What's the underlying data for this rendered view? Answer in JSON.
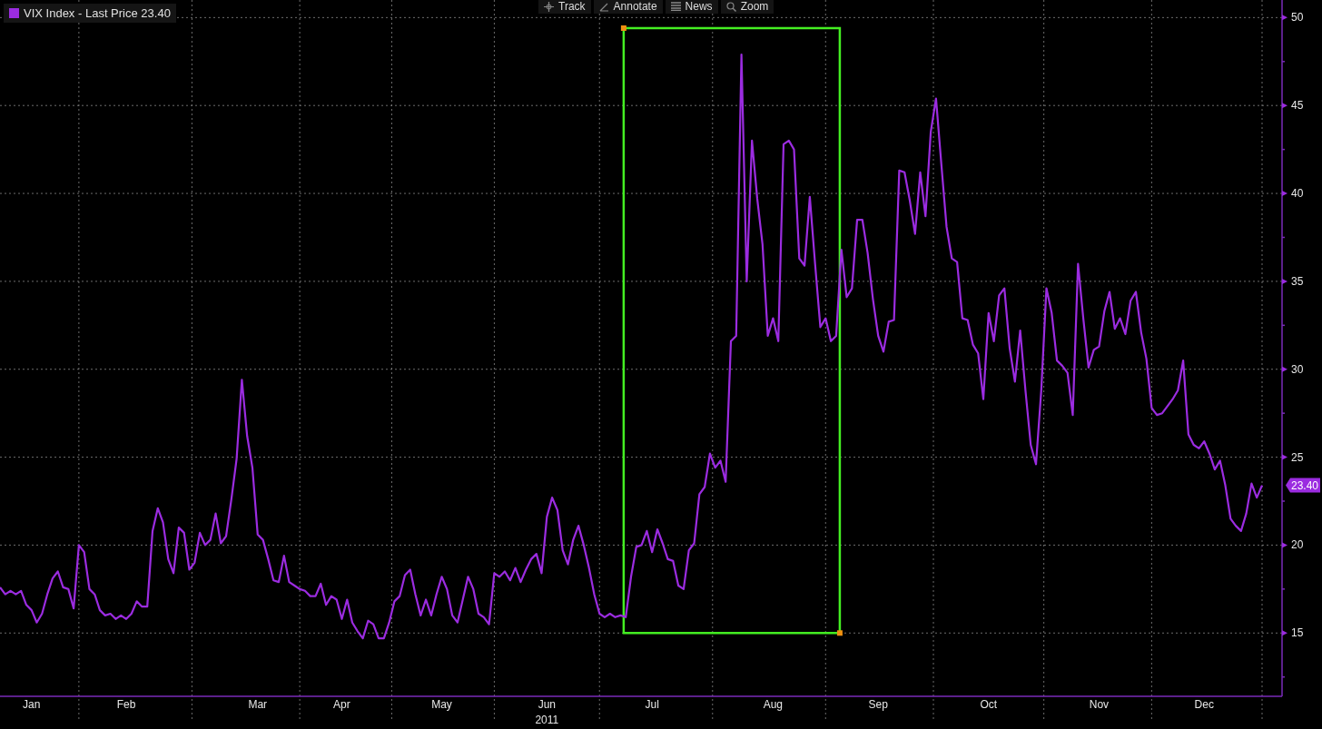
{
  "legend": {
    "value": "23.40"
  },
  "toolbar": [
    {
      "label": "Track",
      "kind": "track"
    },
    {
      "label": "Annotate",
      "kind": "annotate"
    },
    {
      "label": "News",
      "kind": "news"
    },
    {
      "label": "Zoom",
      "kind": "zoom"
    }
  ],
  "last_price_badge": "23.40",
  "chart_data": {
    "type": "line",
    "xlabel": "2011",
    "ylim": [
      11.4,
      51.0
    ],
    "categories": [
      null,
      null,
      null,
      null,
      null,
      null,
      "Jan",
      null,
      null,
      null,
      null,
      null,
      null,
      null,
      null,
      null,
      null,
      null,
      null,
      null,
      null,
      null,
      null,
      null,
      "Feb",
      null,
      null,
      null,
      null,
      null,
      null,
      null,
      null,
      null,
      null,
      null,
      null,
      null,
      null,
      null,
      null,
      null,
      null,
      null,
      null,
      null,
      null,
      null,
      null,
      "Mar",
      null,
      null,
      null,
      null,
      null,
      null,
      null,
      null,
      null,
      null,
      null,
      null,
      null,
      null,
      null,
      "Apr",
      null,
      null,
      null,
      null,
      null,
      null,
      null,
      null,
      null,
      null,
      null,
      null,
      null,
      null,
      null,
      null,
      null,
      null,
      "May",
      null,
      null,
      null,
      null,
      null,
      null,
      null,
      null,
      null,
      null,
      null,
      null,
      null,
      null,
      null,
      null,
      null,
      null,
      null,
      "Jun",
      null,
      null,
      null,
      null,
      null,
      null,
      null,
      null,
      null,
      null,
      null,
      null,
      null,
      null,
      null,
      null,
      null,
      null,
      null,
      "Jul",
      null,
      null,
      null,
      null,
      null,
      null,
      null,
      null,
      null,
      null,
      null,
      null,
      null,
      null,
      null,
      null,
      null,
      null,
      null,
      null,
      null,
      null,
      "Aug",
      null,
      null,
      null,
      null,
      null,
      null,
      null,
      null,
      null,
      null,
      null,
      null,
      null,
      null,
      null,
      null,
      null,
      null,
      null,
      "Sep",
      null,
      null,
      null,
      null,
      null,
      null,
      null,
      null,
      null,
      null,
      null,
      null,
      null,
      null,
      null,
      null,
      null,
      null,
      null,
      null,
      "Oct",
      null,
      null,
      null,
      null,
      null,
      null,
      null,
      null,
      null,
      null,
      null,
      null,
      null,
      null,
      null,
      null,
      null,
      null,
      null,
      null,
      "Nov",
      null,
      null,
      null,
      null,
      null,
      null,
      null,
      null,
      null,
      null,
      null,
      null,
      null,
      null,
      null,
      null,
      null,
      null,
      null,
      "Dec",
      null,
      null,
      null,
      null,
      null,
      null,
      null,
      null,
      null,
      null,
      null
    ],
    "yticks": [
      15,
      20,
      25,
      30,
      35,
      40,
      45,
      50
    ],
    "series": [
      {
        "name": "VIX Index - Last Price",
        "color": "#9b2ce0",
        "values": [
          17.6,
          17.2,
          17.4,
          17.2,
          17.4,
          16.6,
          16.3,
          15.6,
          16.1,
          17.2,
          18.1,
          18.5,
          17.6,
          17.5,
          16.4,
          20.0,
          19.6,
          17.5,
          17.2,
          16.3,
          16.0,
          16.1,
          15.8,
          16.0,
          15.8,
          16.1,
          16.8,
          16.5,
          16.5,
          20.8,
          22.1,
          21.3,
          19.2,
          18.4,
          21.0,
          20.7,
          18.6,
          19.0,
          20.7,
          20.0,
          20.3,
          21.8,
          20.1,
          20.5,
          22.6,
          24.9,
          29.4,
          26.2,
          24.4,
          20.6,
          20.3,
          19.2,
          18.0,
          17.9,
          19.4,
          17.9,
          17.7,
          17.5,
          17.4,
          17.1,
          17.1,
          17.8,
          16.6,
          17.1,
          16.9,
          15.8,
          16.9,
          15.6,
          15.1,
          14.7,
          15.7,
          15.5,
          14.7,
          14.7,
          15.6,
          16.8,
          17.1,
          18.3,
          18.6,
          17.2,
          16.0,
          16.9,
          16.0,
          17.2,
          18.2,
          17.5,
          16.0,
          15.6,
          16.9,
          18.2,
          17.5,
          16.1,
          15.9,
          15.5,
          18.4,
          18.2,
          18.5,
          18.0,
          18.7,
          17.9,
          18.6,
          19.2,
          19.5,
          18.4,
          21.6,
          22.7,
          22.0,
          19.7,
          18.9,
          20.3,
          21.1,
          20.0,
          18.7,
          17.2,
          16.1,
          15.9,
          16.1,
          15.9,
          16.0,
          15.9,
          18.2,
          19.9,
          20.0,
          20.8,
          19.6,
          20.9,
          20.1,
          19.2,
          19.1,
          17.7,
          17.5,
          19.7,
          20.1,
          22.9,
          23.3,
          25.2,
          24.4,
          24.8,
          23.6,
          31.6,
          31.9,
          47.9,
          35.0,
          43.0,
          39.7,
          37.1,
          31.9,
          32.9,
          31.6,
          42.8,
          43.0,
          42.5,
          36.3,
          35.9,
          39.8,
          36.0,
          32.4,
          32.9,
          31.6,
          31.9,
          36.8,
          34.1,
          34.6,
          38.5,
          38.5,
          36.6,
          34.0,
          31.9,
          31.0,
          32.7,
          32.8,
          41.3,
          41.2,
          39.6,
          37.7,
          41.2,
          38.7,
          43.5,
          45.4,
          41.7,
          38.1,
          36.3,
          36.1,
          32.9,
          32.8,
          31.4,
          30.9,
          28.3,
          33.2,
          31.6,
          34.2,
          34.6,
          31.2,
          29.3,
          32.2,
          28.8,
          25.7,
          24.6,
          28.8,
          34.6,
          33.2,
          30.5,
          30.2,
          29.8,
          27.4,
          36.0,
          32.9,
          30.1,
          31.1,
          31.3,
          33.3,
          34.4,
          32.3,
          32.9,
          32.0,
          33.9,
          34.4,
          32.1,
          30.6,
          27.8,
          27.4,
          27.5,
          27.9,
          28.3,
          28.8,
          30.5,
          26.3,
          25.7,
          25.5,
          25.9,
          25.2,
          24.3,
          24.8,
          23.4,
          21.5,
          21.1,
          20.8,
          21.8,
          23.5,
          22.7,
          23.4
        ]
      }
    ],
    "grid": true
  }
}
